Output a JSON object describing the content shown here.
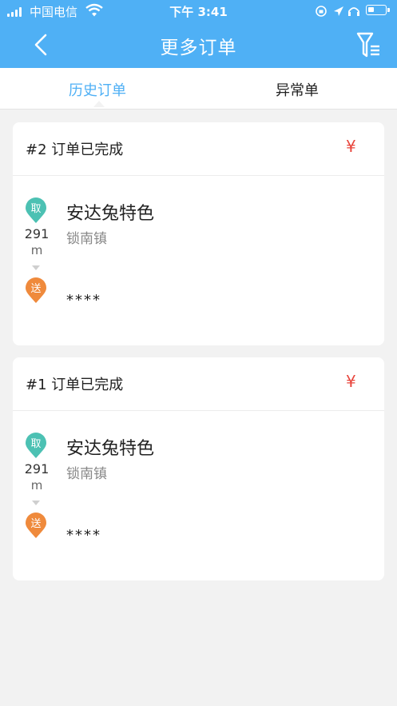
{
  "status_bar": {
    "carrier": "中国电信",
    "time": "下午 3:41"
  },
  "nav": {
    "title": "更多订单",
    "back_icon": "chevron-left-icon",
    "filter_icon": "filter-list-icon"
  },
  "tabs": [
    {
      "label": "历史订单",
      "active": true
    },
    {
      "label": "异常单",
      "active": false
    }
  ],
  "orders": [
    {
      "title": "#2 订单已完成",
      "price": "¥",
      "pickup_badge": "取",
      "distance": "291",
      "distance_unit": "m",
      "dropoff_badge": "送",
      "shop_name": "安达兔特色",
      "shop_address": "锁南镇",
      "destination": "****"
    },
    {
      "title": "#1 订单已完成",
      "price": "¥",
      "pickup_badge": "取",
      "distance": "291",
      "distance_unit": "m",
      "dropoff_badge": "送",
      "shop_name": "安达兔特色",
      "shop_address": "锁南镇",
      "destination": "****"
    }
  ],
  "colors": {
    "header": "#4fb0f5",
    "pickup_pin": "#4cc1b3",
    "dropoff_pin": "#ef8a3c",
    "price": "#e8453c"
  }
}
